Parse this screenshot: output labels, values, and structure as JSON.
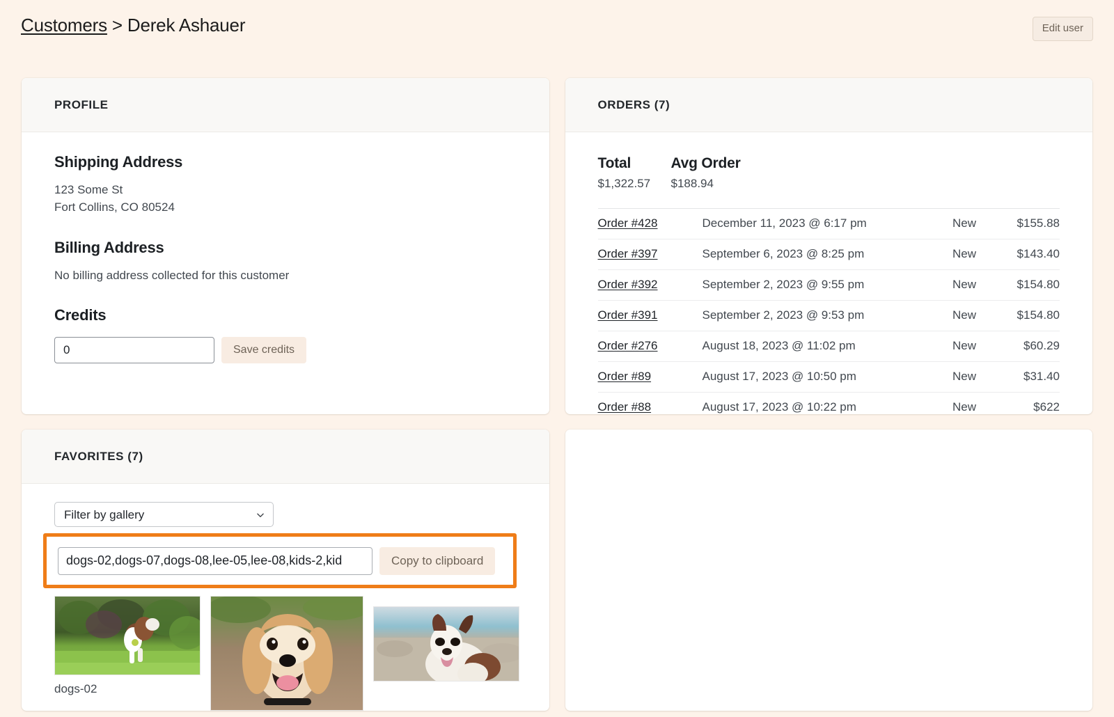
{
  "header": {
    "breadcrumb_root": "Customers",
    "breadcrumb_separator": ">",
    "breadcrumb_current": "Derek Ashauer",
    "edit_user_label": "Edit user"
  },
  "profile": {
    "card_title": "PROFILE",
    "shipping_heading": "Shipping Address",
    "shipping_line1": "123 Some St",
    "shipping_line2": "Fort Collins, CO 80524",
    "billing_heading": "Billing Address",
    "billing_empty_text": "No billing address collected for this customer",
    "credits_heading": "Credits",
    "credits_value": "0",
    "credits_placeholder": "0",
    "save_credits_label": "Save credits"
  },
  "orders": {
    "card_title": "ORDERS (7)",
    "total_label": "Total",
    "total_value": "$1,322.57",
    "avg_label": "Avg Order",
    "avg_value": "$188.94",
    "rows": [
      {
        "order": "Order #428",
        "date": "December 11, 2023 @ 6:17 pm",
        "status": "New",
        "total": "$155.88"
      },
      {
        "order": "Order #397",
        "date": "September 6, 2023 @ 8:25 pm",
        "status": "New",
        "total": "$143.40"
      },
      {
        "order": "Order #392",
        "date": "September 2, 2023 @ 9:55 pm",
        "status": "New",
        "total": "$154.80"
      },
      {
        "order": "Order #391",
        "date": "September 2, 2023 @ 9:53 pm",
        "status": "New",
        "total": "$154.80"
      },
      {
        "order": "Order #276",
        "date": "August 18, 2023 @ 11:02 pm",
        "status": "New",
        "total": "$60.29"
      },
      {
        "order": "Order #89",
        "date": "August 17, 2023 @ 10:50 pm",
        "status": "New",
        "total": "$31.40"
      },
      {
        "order": "Order #88",
        "date": "August 17, 2023 @ 10:22 pm",
        "status": "New",
        "total": "$622"
      }
    ]
  },
  "favorites": {
    "card_title": "FAVORITES (7)",
    "gallery_filter_selected": "Filter by gallery",
    "gallery_filter_options": [
      "Filter by gallery"
    ],
    "ids_value": "dogs-02,dogs-07,dogs-08,lee-05,lee-08,kids-2,kid",
    "copy_label": "Copy to clipboard",
    "highlight_color": "#ef7d18",
    "thumbnails": [
      {
        "label": "dogs-02",
        "alt": "border collie running on grass with ball"
      },
      {
        "label": "",
        "alt": "beagle puppy smiling on dirt path"
      },
      {
        "label": "",
        "alt": "australian shepherd at the beach"
      }
    ]
  }
}
